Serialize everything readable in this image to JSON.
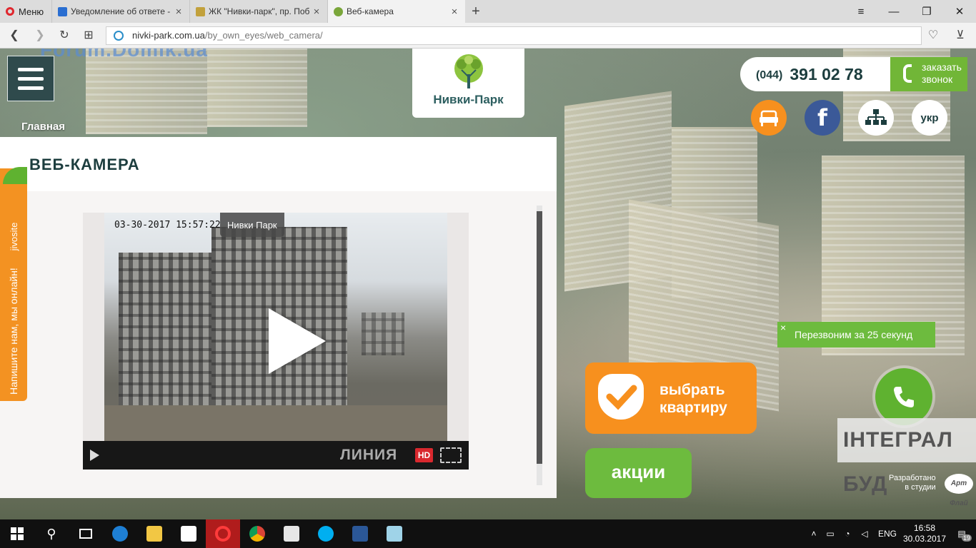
{
  "browser": {
    "menu_label": "Меню",
    "tabs": [
      {
        "title": "Уведомление об ответе -",
        "active": false
      },
      {
        "title": "ЖК \"Нивки-парк\", пр. Поб",
        "active": false
      },
      {
        "title": "Веб-камера",
        "active": true
      }
    ],
    "url_host": "nivki-park.com.ua",
    "url_path": "/by_own_eyes/web_camera/"
  },
  "watermark": "Forum.Domik.ua",
  "site": {
    "breadcrumb": "Главная",
    "logo_name": "Нивки-Парк",
    "phone_code": "(044)",
    "phone_number": "391 02 78",
    "callback_label_1": "заказать",
    "callback_label_2": "звонок",
    "lang_label": "укр",
    "fb_glyph": "f"
  },
  "panel": {
    "title": "ВЕБ-КАМЕРА",
    "camera": {
      "timestamp": "03-30-2017 15:57:22",
      "name": "Нивки Парк",
      "brand": "ЛИНИЯ",
      "hd_label": "HD"
    }
  },
  "jivosite": {
    "text": "Напишите нам, мы онлайн!",
    "brand": "jivosite"
  },
  "widgets": {
    "callme_text": "Перезвоним за 25 секунд",
    "close_glyph": "×",
    "choose_line1": "выбрать",
    "choose_line2": "квартиру",
    "promo_label": "акции",
    "integral_text": "ІНТЕГРАЛ БУД",
    "dev_line1": "Разработано",
    "dev_line2": "в студии",
    "dev_logo": "Арт Флай"
  },
  "taskbar": {
    "language": "ENG",
    "time": "16:58",
    "date": "30.03.2017",
    "notifications": "19"
  },
  "colors": {
    "accent_green": "#6dbb3e",
    "accent_orange": "#f7901e",
    "brand_dark": "#1c3d3e"
  }
}
